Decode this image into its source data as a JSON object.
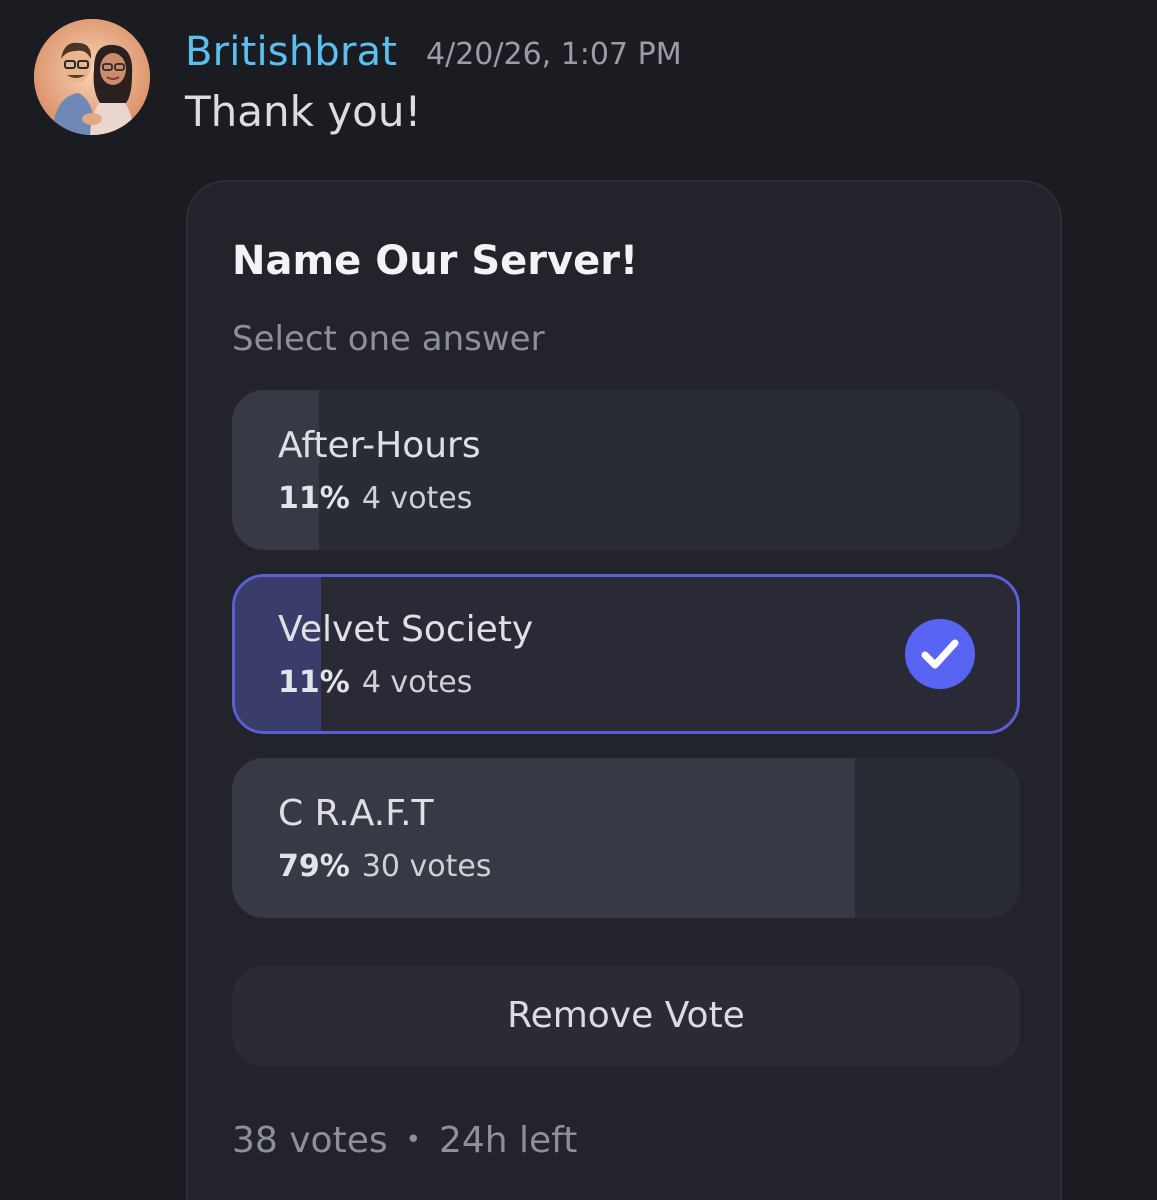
{
  "message": {
    "author": "Britishbrat",
    "timestamp": "4/20/26, 1:07 PM",
    "text": "Thank you!",
    "author_color": "#5bc0ee"
  },
  "poll": {
    "title": "Name Our Server!",
    "subtitle": "Select one answer",
    "answers": [
      {
        "label": "After-Hours",
        "percent": "11%",
        "votes": "4 votes",
        "fraction": 0.11,
        "selected": false
      },
      {
        "label": "Velvet Society",
        "percent": "11%",
        "votes": "4 votes",
        "fraction": 0.11,
        "selected": true
      },
      {
        "label": "C R.A.F.T",
        "percent": "79%",
        "votes": "30 votes",
        "fraction": 0.79,
        "selected": false
      }
    ],
    "remove_vote_label": "Remove Vote",
    "total_votes": "38 votes",
    "separator": "•",
    "time_left": "24h left",
    "accent_color": "#5865f2"
  },
  "icons": {
    "avatar": "couple-cartoon-avatar",
    "selected": "checkmark-circle-icon"
  }
}
